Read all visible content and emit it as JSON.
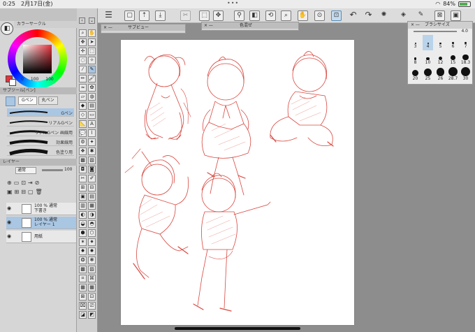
{
  "status_bar": {
    "time": "0:25",
    "date": "2月17日(金)",
    "battery": "84%"
  },
  "panels": {
    "color_circle_title": "カラーサークル",
    "color_values": [
      "0",
      "100",
      "100"
    ],
    "sub_tool_title": "サブツール[ペン]",
    "sub_tool_tabs": [
      "Gペン",
      "丸ペン"
    ],
    "brushes": [
      "Gペン",
      "リアルGペン",
      "リアルGペン 画線用",
      "効果線用",
      "色塗り用"
    ],
    "layer_title": "レイヤー",
    "blend_mode": "通常",
    "opacity": "100",
    "layers": [
      {
        "line1": "100 % 通常",
        "line2": "下書き"
      },
      {
        "line1": "100 % 通常",
        "line2": "レイヤー 1"
      },
      {
        "line1": "",
        "line2": "用紙"
      }
    ]
  },
  "floating": {
    "sub_view_title": "サブビュー",
    "color_set_title": "色混ぜ",
    "brush_size_title": "ブラシサイズ",
    "brush_size_value": "4.0",
    "brush_sizes": [
      "3",
      "4",
      "5",
      "6",
      "7",
      "8",
      "10",
      "12",
      "15",
      "18.3",
      "20",
      "25",
      "26",
      "28.7",
      "30"
    ],
    "selected_size": "4"
  },
  "accent": {
    "selection_blue": "#a9c6e3",
    "sketch_red": "#d9473f",
    "color_red": "#e8323c"
  }
}
